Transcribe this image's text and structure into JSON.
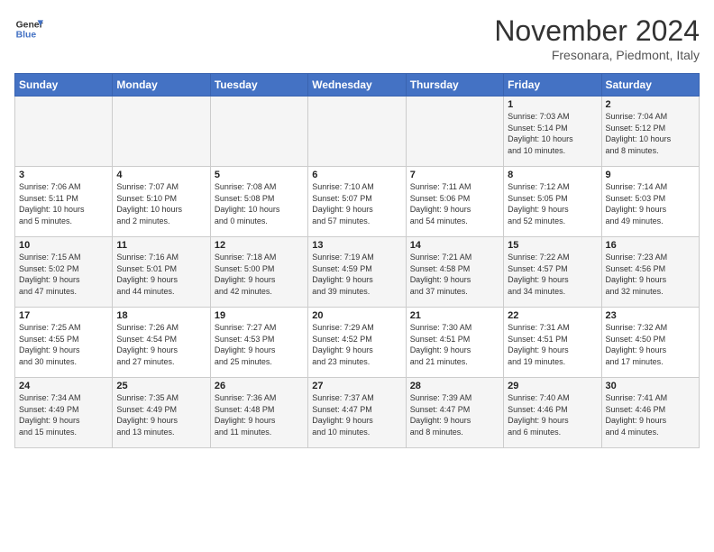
{
  "header": {
    "logo_line1": "General",
    "logo_line2": "Blue",
    "month_title": "November 2024",
    "location": "Fresonara, Piedmont, Italy"
  },
  "weekdays": [
    "Sunday",
    "Monday",
    "Tuesday",
    "Wednesday",
    "Thursday",
    "Friday",
    "Saturday"
  ],
  "weeks": [
    [
      {
        "day": "",
        "info": ""
      },
      {
        "day": "",
        "info": ""
      },
      {
        "day": "",
        "info": ""
      },
      {
        "day": "",
        "info": ""
      },
      {
        "day": "",
        "info": ""
      },
      {
        "day": "1",
        "info": "Sunrise: 7:03 AM\nSunset: 5:14 PM\nDaylight: 10 hours\nand 10 minutes."
      },
      {
        "day": "2",
        "info": "Sunrise: 7:04 AM\nSunset: 5:12 PM\nDaylight: 10 hours\nand 8 minutes."
      }
    ],
    [
      {
        "day": "3",
        "info": "Sunrise: 7:06 AM\nSunset: 5:11 PM\nDaylight: 10 hours\nand 5 minutes."
      },
      {
        "day": "4",
        "info": "Sunrise: 7:07 AM\nSunset: 5:10 PM\nDaylight: 10 hours\nand 2 minutes."
      },
      {
        "day": "5",
        "info": "Sunrise: 7:08 AM\nSunset: 5:08 PM\nDaylight: 10 hours\nand 0 minutes."
      },
      {
        "day": "6",
        "info": "Sunrise: 7:10 AM\nSunset: 5:07 PM\nDaylight: 9 hours\nand 57 minutes."
      },
      {
        "day": "7",
        "info": "Sunrise: 7:11 AM\nSunset: 5:06 PM\nDaylight: 9 hours\nand 54 minutes."
      },
      {
        "day": "8",
        "info": "Sunrise: 7:12 AM\nSunset: 5:05 PM\nDaylight: 9 hours\nand 52 minutes."
      },
      {
        "day": "9",
        "info": "Sunrise: 7:14 AM\nSunset: 5:03 PM\nDaylight: 9 hours\nand 49 minutes."
      }
    ],
    [
      {
        "day": "10",
        "info": "Sunrise: 7:15 AM\nSunset: 5:02 PM\nDaylight: 9 hours\nand 47 minutes."
      },
      {
        "day": "11",
        "info": "Sunrise: 7:16 AM\nSunset: 5:01 PM\nDaylight: 9 hours\nand 44 minutes."
      },
      {
        "day": "12",
        "info": "Sunrise: 7:18 AM\nSunset: 5:00 PM\nDaylight: 9 hours\nand 42 minutes."
      },
      {
        "day": "13",
        "info": "Sunrise: 7:19 AM\nSunset: 4:59 PM\nDaylight: 9 hours\nand 39 minutes."
      },
      {
        "day": "14",
        "info": "Sunrise: 7:21 AM\nSunset: 4:58 PM\nDaylight: 9 hours\nand 37 minutes."
      },
      {
        "day": "15",
        "info": "Sunrise: 7:22 AM\nSunset: 4:57 PM\nDaylight: 9 hours\nand 34 minutes."
      },
      {
        "day": "16",
        "info": "Sunrise: 7:23 AM\nSunset: 4:56 PM\nDaylight: 9 hours\nand 32 minutes."
      }
    ],
    [
      {
        "day": "17",
        "info": "Sunrise: 7:25 AM\nSunset: 4:55 PM\nDaylight: 9 hours\nand 30 minutes."
      },
      {
        "day": "18",
        "info": "Sunrise: 7:26 AM\nSunset: 4:54 PM\nDaylight: 9 hours\nand 27 minutes."
      },
      {
        "day": "19",
        "info": "Sunrise: 7:27 AM\nSunset: 4:53 PM\nDaylight: 9 hours\nand 25 minutes."
      },
      {
        "day": "20",
        "info": "Sunrise: 7:29 AM\nSunset: 4:52 PM\nDaylight: 9 hours\nand 23 minutes."
      },
      {
        "day": "21",
        "info": "Sunrise: 7:30 AM\nSunset: 4:51 PM\nDaylight: 9 hours\nand 21 minutes."
      },
      {
        "day": "22",
        "info": "Sunrise: 7:31 AM\nSunset: 4:51 PM\nDaylight: 9 hours\nand 19 minutes."
      },
      {
        "day": "23",
        "info": "Sunrise: 7:32 AM\nSunset: 4:50 PM\nDaylight: 9 hours\nand 17 minutes."
      }
    ],
    [
      {
        "day": "24",
        "info": "Sunrise: 7:34 AM\nSunset: 4:49 PM\nDaylight: 9 hours\nand 15 minutes."
      },
      {
        "day": "25",
        "info": "Sunrise: 7:35 AM\nSunset: 4:49 PM\nDaylight: 9 hours\nand 13 minutes."
      },
      {
        "day": "26",
        "info": "Sunrise: 7:36 AM\nSunset: 4:48 PM\nDaylight: 9 hours\nand 11 minutes."
      },
      {
        "day": "27",
        "info": "Sunrise: 7:37 AM\nSunset: 4:47 PM\nDaylight: 9 hours\nand 10 minutes."
      },
      {
        "day": "28",
        "info": "Sunrise: 7:39 AM\nSunset: 4:47 PM\nDaylight: 9 hours\nand 8 minutes."
      },
      {
        "day": "29",
        "info": "Sunrise: 7:40 AM\nSunset: 4:46 PM\nDaylight: 9 hours\nand 6 minutes."
      },
      {
        "day": "30",
        "info": "Sunrise: 7:41 AM\nSunset: 4:46 PM\nDaylight: 9 hours\nand 4 minutes."
      }
    ]
  ]
}
